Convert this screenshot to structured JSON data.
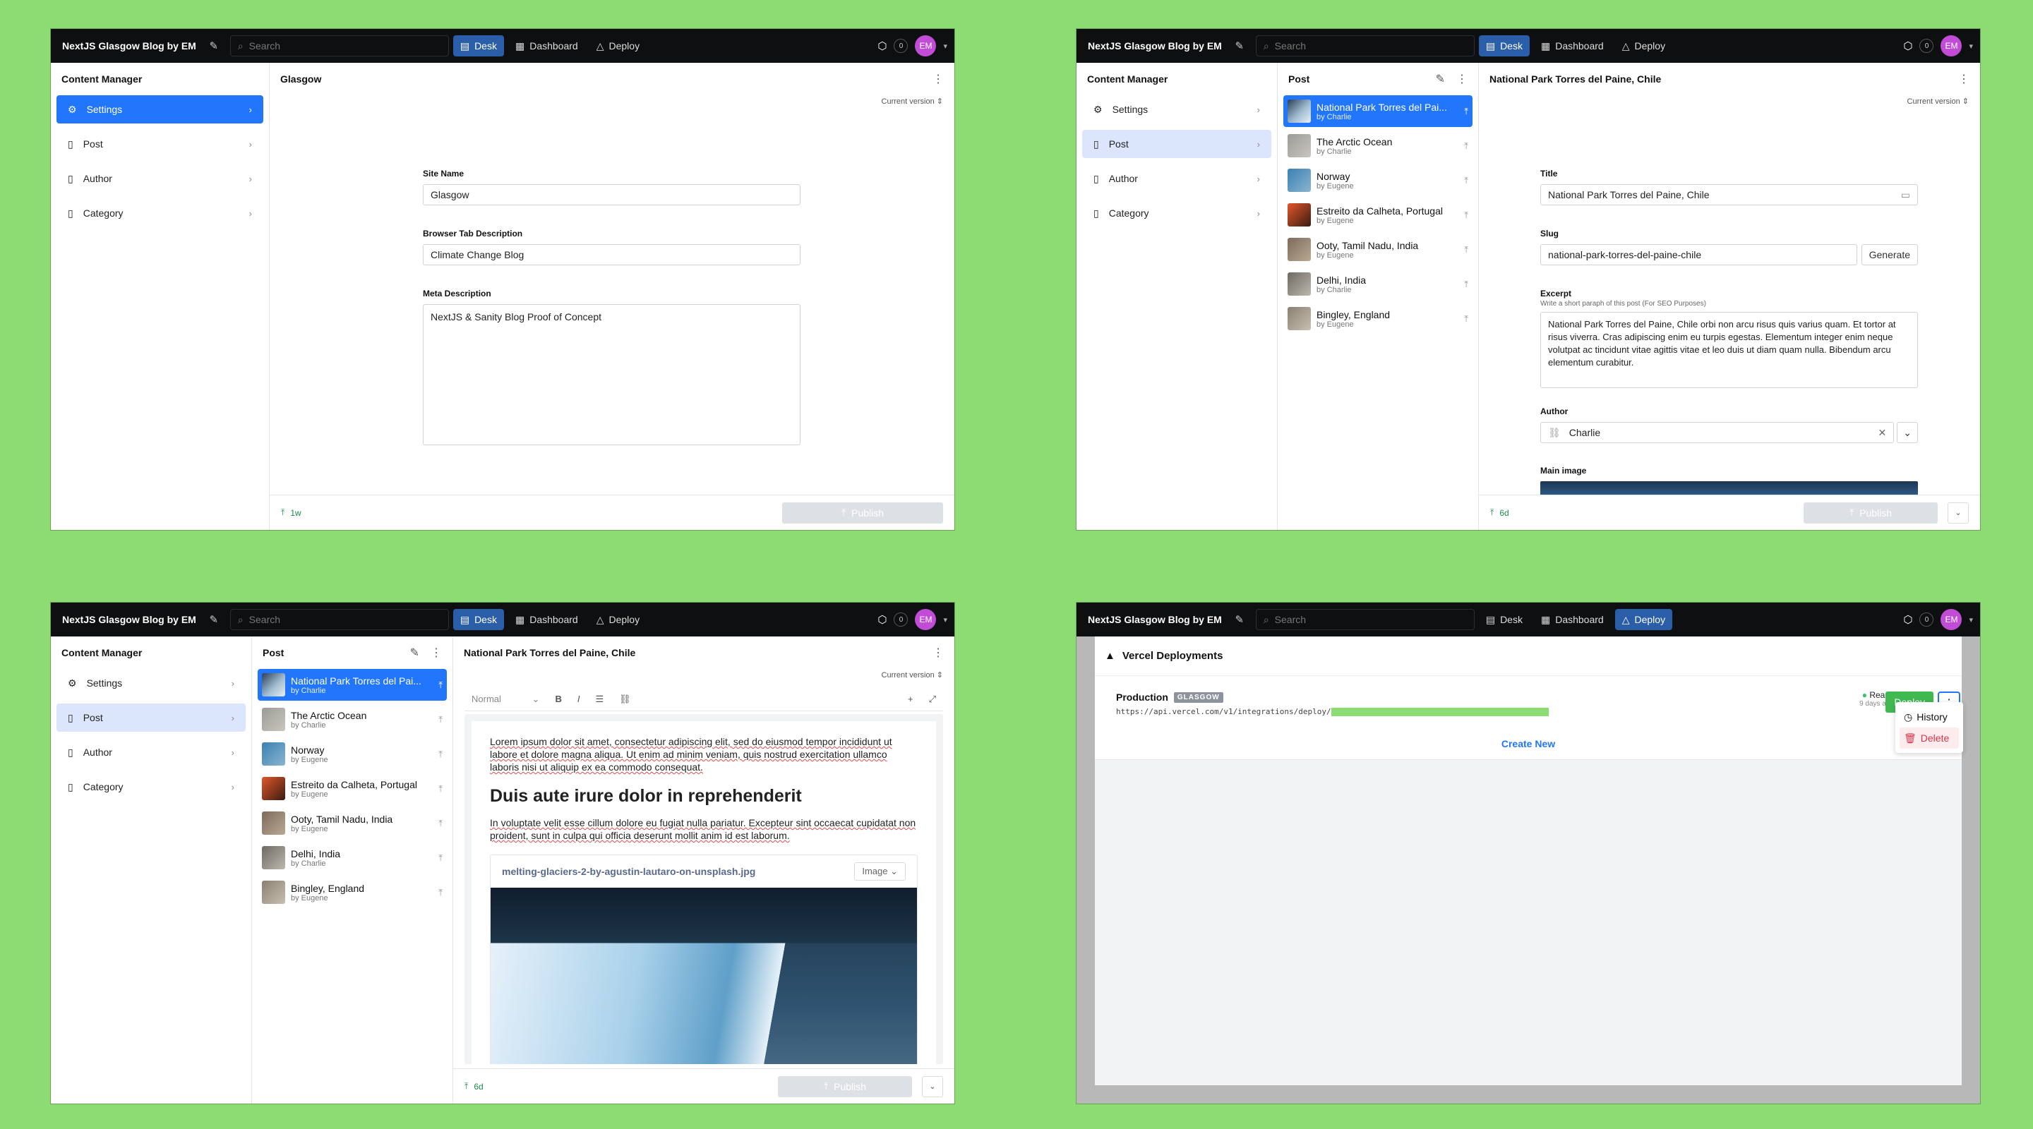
{
  "nav": {
    "brand": "NextJS Glasgow Blog by EM",
    "search_placeholder": "Search",
    "tools": [
      "Desk",
      "Dashboard",
      "Deploy"
    ],
    "badge": "0",
    "avatar": "EM"
  },
  "desk": {
    "title": "Content Manager",
    "items": [
      "Settings",
      "Post",
      "Author",
      "Category"
    ]
  },
  "post_list": {
    "title": "Post",
    "items": [
      {
        "title": "National Park Torres del Paine, Chile",
        "short": "National Park Torres del Pai...",
        "by": "by Charlie"
      },
      {
        "title": "The Arctic Ocean",
        "by": "by Charlie"
      },
      {
        "title": "Norway",
        "by": "by Eugene"
      },
      {
        "title": "Estreito da Calheta, Portugal",
        "by": "by Eugene"
      },
      {
        "title": "Ooty, Tamil Nadu, India",
        "by": "by Eugene"
      },
      {
        "title": "Delhi, India",
        "by": "by Charlie"
      },
      {
        "title": "Bingley, England",
        "by": "by Eugene"
      }
    ]
  },
  "settings_doc": {
    "title": "Glasgow",
    "current_version": "Current version",
    "site_name_label": "Site Name",
    "site_name": "Glasgow",
    "tab_desc_label": "Browser Tab Description",
    "tab_desc": "Climate Change Blog",
    "meta_label": "Meta Description",
    "meta": "NextJS & Sanity Blog Proof of Concept",
    "footer_time": "1w",
    "publish": "Publish"
  },
  "post_doc": {
    "title": "National Park Torres del Paine, Chile",
    "current_version": "Current version",
    "title_label": "Title",
    "title_value": "National Park Torres del Paine, Chile",
    "slug_label": "Slug",
    "slug": "national-park-torres-del-paine-chile",
    "generate": "Generate",
    "excerpt_label": "Excerpt",
    "excerpt_hint": "Write a short paraph of this post (For SEO Purposes)",
    "excerpt": "National Park Torres del Paine, Chile orbi non arcu risus quis varius quam. Et tortor at risus viverra. Cras adipiscing enim eu turpis egestas. Elementum integer enim neque volutpat ac tincidunt vitae agittis vitae et leo duis ut diam quam nulla. Bibendum arcu elementum curabitur.",
    "author_label": "Author",
    "author": "Charlie",
    "main_image_label": "Main image",
    "footer_time": "6d",
    "publish": "Publish"
  },
  "editor": {
    "style": "Normal",
    "p1": "Lorem ipsum dolor sit amet, consectetur adipiscing elit, sed do eiusmod tempor incididunt ut labore et dolore magna aliqua. Ut enim ad minim veniam, quis nostrud exercitation ullamco laboris nisi ut aliquip ex ea commodo consequat.",
    "h2": "Duis aute irure dolor in reprehenderit",
    "p2": "In voluptate velit esse cillum dolore eu fugiat nulla pariatur. Excepteur sint occaecat cupidatat non proident, sunt in culpa qui officia deserunt mollit anim id est laborum.",
    "image_file": "melting-glaciers-2-by-agustin-lautaro-on-unsplash.jpg",
    "image_type": "Image"
  },
  "deploy": {
    "heading": "Vercel Deployments",
    "name": "Production",
    "tag": "GLASGOW",
    "url": "https://api.vercel.com/v1/integrations/deploy/",
    "status": "Ready",
    "age": "9 days ago",
    "deploy_btn": "Deploy",
    "menu": [
      "History",
      "Delete"
    ],
    "create_new": "Create New"
  },
  "colors": {
    "accent": "#2276fc",
    "deploy_green": "#3fb950",
    "bg": "#8ddc73"
  }
}
